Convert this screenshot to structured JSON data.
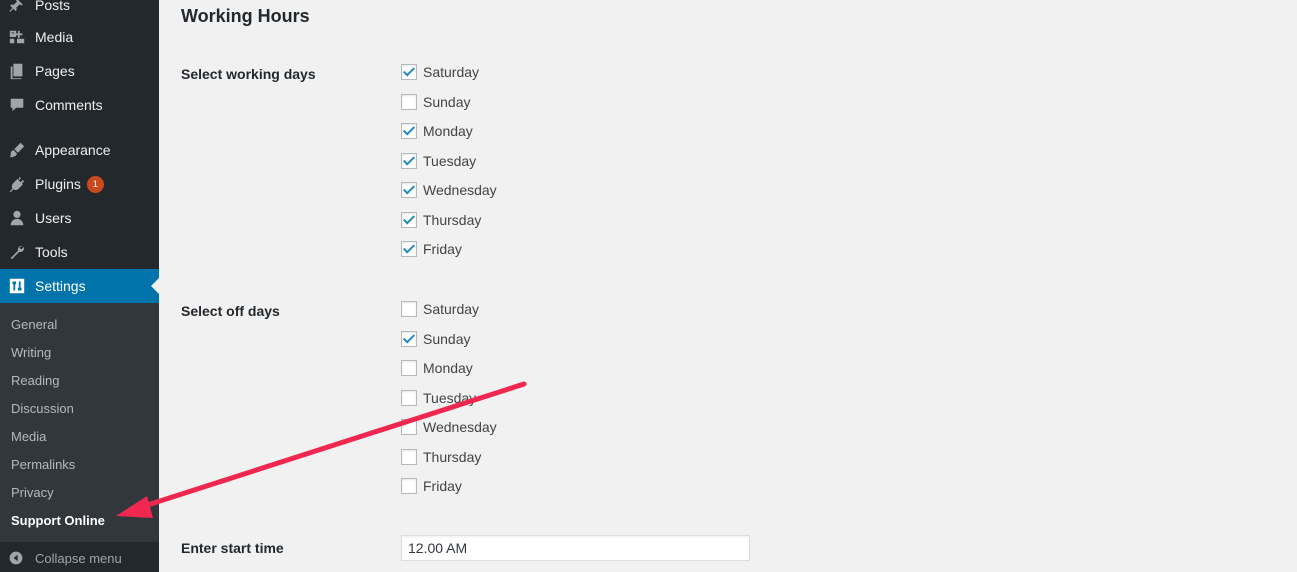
{
  "sidebar": {
    "items": [
      {
        "label": "Posts",
        "icon": "pin-icon"
      },
      {
        "label": "Media",
        "icon": "media-icon"
      },
      {
        "label": "Pages",
        "icon": "pages-icon"
      },
      {
        "label": "Comments",
        "icon": "comments-icon"
      },
      {
        "label": "Appearance",
        "icon": "brush-icon"
      },
      {
        "label": "Plugins",
        "icon": "plug-icon",
        "badge": "1"
      },
      {
        "label": "Users",
        "icon": "user-icon"
      },
      {
        "label": "Tools",
        "icon": "wrench-icon"
      },
      {
        "label": "Settings",
        "icon": "settings-icon",
        "active": true
      }
    ],
    "submenu": [
      "General",
      "Writing",
      "Reading",
      "Discussion",
      "Media",
      "Permalinks",
      "Privacy",
      "Support Online"
    ],
    "current_submenu": "Support Online",
    "collapse_label": "Collapse menu"
  },
  "main": {
    "title": "Working Hours",
    "working_days": {
      "label": "Select working days",
      "options": [
        {
          "label": "Saturday",
          "checked": true
        },
        {
          "label": "Sunday",
          "checked": false
        },
        {
          "label": "Monday",
          "checked": true
        },
        {
          "label": "Tuesday",
          "checked": true
        },
        {
          "label": "Wednesday",
          "checked": true
        },
        {
          "label": "Thursday",
          "checked": true
        },
        {
          "label": "Friday",
          "checked": true
        }
      ]
    },
    "off_days": {
      "label": "Select off days",
      "options": [
        {
          "label": "Saturday",
          "checked": false
        },
        {
          "label": "Sunday",
          "checked": true
        },
        {
          "label": "Monday",
          "checked": false
        },
        {
          "label": "Tuesday",
          "checked": false
        },
        {
          "label": "Wednesday",
          "checked": false
        },
        {
          "label": "Thursday",
          "checked": false
        },
        {
          "label": "Friday",
          "checked": false
        }
      ]
    },
    "start_time": {
      "label": "Enter start time",
      "value": "12.00 AM"
    }
  },
  "colors": {
    "sidebar_bg": "#23282d",
    "submenu_bg": "#32373c",
    "active_bg": "#0073aa",
    "badge_bg": "#ca4a1f",
    "annotation_arrow": "#f0284f",
    "checkmark": "#1e8cbe"
  }
}
